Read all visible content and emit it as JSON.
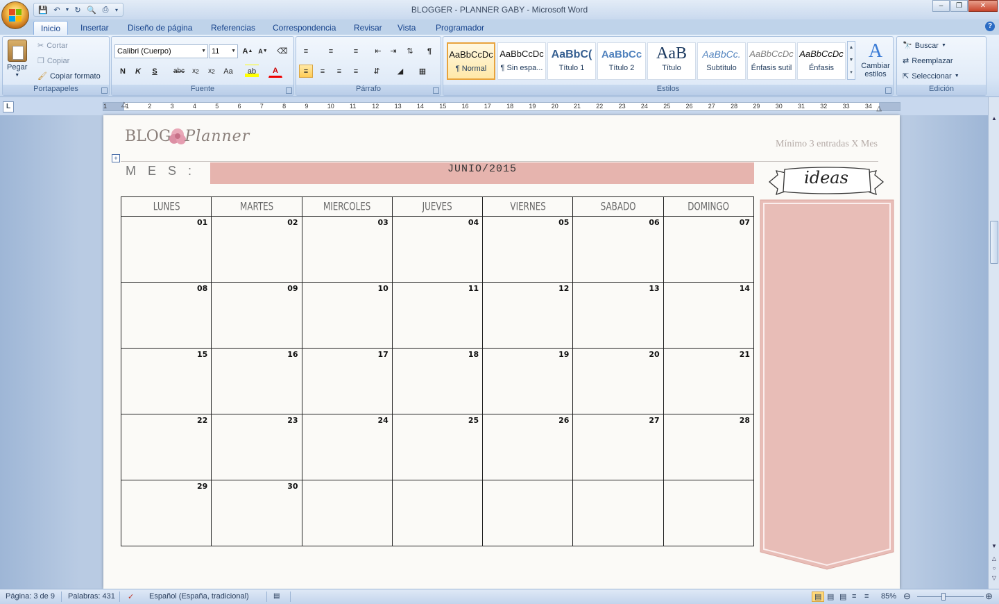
{
  "window": {
    "title": "BLOGGER - PLANNER GABY - Microsoft Word"
  },
  "tabs": [
    "Inicio",
    "Insertar",
    "Diseño de página",
    "Referencias",
    "Correspondencia",
    "Revisar",
    "Vista",
    "Programador"
  ],
  "ribbon": {
    "clipboard": {
      "paste": "Pegar",
      "cut": "Cortar",
      "copy": "Copiar",
      "format_painter": "Copiar formato",
      "label": "Portapapeles"
    },
    "font": {
      "name": "Calibri (Cuerpo)",
      "size": "11",
      "label": "Fuente"
    },
    "paragraph": {
      "label": "Párrafo"
    },
    "styles": {
      "label": "Estilos",
      "items": [
        {
          "preview": "AaBbCcDc",
          "name": "¶ Normal"
        },
        {
          "preview": "AaBbCcDc",
          "name": "¶ Sin espa..."
        },
        {
          "preview": "AaBbC(",
          "name": "Título 1"
        },
        {
          "preview": "AaBbCc",
          "name": "Título 2"
        },
        {
          "preview": "AaB",
          "name": "Título"
        },
        {
          "preview": "AaBbCc.",
          "name": "Subtítulo"
        },
        {
          "preview": "AaBbCcDc",
          "name": "Énfasis sutil"
        },
        {
          "preview": "AaBbCcDc",
          "name": "Énfasis"
        }
      ],
      "change_styles": "Cambiar estilos"
    },
    "editing": {
      "find": "Buscar",
      "replace": "Reemplazar",
      "select": "Seleccionar",
      "label": "Edición"
    }
  },
  "ruler": {
    "numbers": [
      "1",
      "1",
      "2",
      "3",
      "4",
      "5",
      "6",
      "7",
      "8",
      "9",
      "10",
      "11",
      "12",
      "13",
      "14",
      "15",
      "16",
      "17",
      "18",
      "19",
      "20",
      "21",
      "22",
      "23",
      "24",
      "25",
      "26",
      "27",
      "28",
      "29",
      "30",
      "31",
      "32",
      "33",
      "34"
    ]
  },
  "document": {
    "logo_left": "BLOG",
    "logo_right": "Planner",
    "tagline": "Mínimo 3 entradas X Mes",
    "month_label": "M E S :",
    "month_value": "JUNIO/2015",
    "weekdays": [
      "LUNES",
      "MARTES",
      "MIERCOLES",
      "JUEVES",
      "VIERNES",
      "SABADO",
      "DOMINGO"
    ],
    "weeks": [
      [
        "01",
        "02",
        "03",
        "04",
        "05",
        "06",
        "07"
      ],
      [
        "08",
        "09",
        "10",
        "11",
        "12",
        "13",
        "14"
      ],
      [
        "15",
        "16",
        "17",
        "18",
        "19",
        "20",
        "21"
      ],
      [
        "22",
        "23",
        "24",
        "25",
        "26",
        "27",
        "28"
      ],
      [
        "29",
        "30",
        "",
        "",
        "",
        "",
        ""
      ]
    ],
    "ideas_title": "ideas"
  },
  "status": {
    "page": "Página: 3 de 9",
    "words": "Palabras: 431",
    "language": "Español (España, tradicional)",
    "zoom": "85%"
  },
  "colors": {
    "month_bar": "#e6b4ae",
    "ideas_panel": "#e8bdb7",
    "ribbon": "#dbe7f6"
  }
}
